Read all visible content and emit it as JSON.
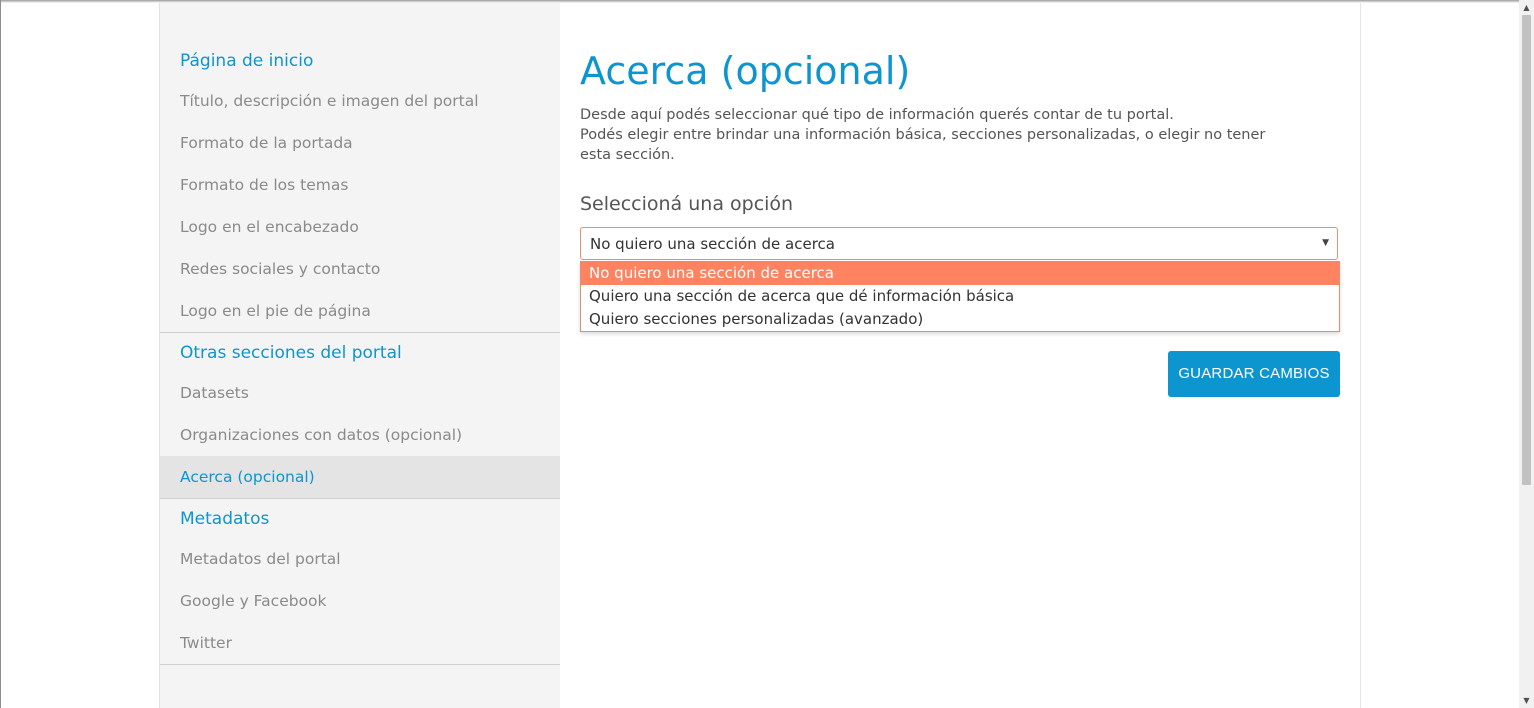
{
  "sidebar": {
    "sections": [
      {
        "heading": "Página de inicio",
        "items": [
          "Título, descripción e imagen del portal",
          "Formato de la portada",
          "Formato de los temas",
          "Logo en el encabezado",
          "Redes sociales y contacto",
          "Logo en el pie de página"
        ]
      },
      {
        "heading": "Otras secciones del portal",
        "items": [
          "Datasets",
          "Organizaciones con datos (opcional)",
          "Acerca (opcional)"
        ]
      },
      {
        "heading": "Metadatos",
        "items": [
          "Metadatos del portal",
          "Google y Facebook",
          "Twitter"
        ]
      }
    ],
    "active_item": "Acerca (opcional)"
  },
  "main": {
    "title": "Acerca (opcional)",
    "description_line1": "Desde aquí podés seleccionar qué tipo de información querés contar de tu portal.",
    "description_line2": "Podés elegir entre brindar una información básica, secciones personalizadas, o elegir no tener esta sección.",
    "select_label": "Seleccioná una opción",
    "select_value": "No quiero una sección de acerca",
    "options": [
      "No quiero una sección de acerca",
      "Quiero una sección de acerca que dé información básica",
      "Quiero secciones personalizadas (avanzado)"
    ],
    "save_label": "GUARDAR CAMBIOS"
  },
  "colors": {
    "accent": "#0d95cf",
    "highlight": "#ff8360",
    "sidebar_bg": "#f4f4f4"
  }
}
